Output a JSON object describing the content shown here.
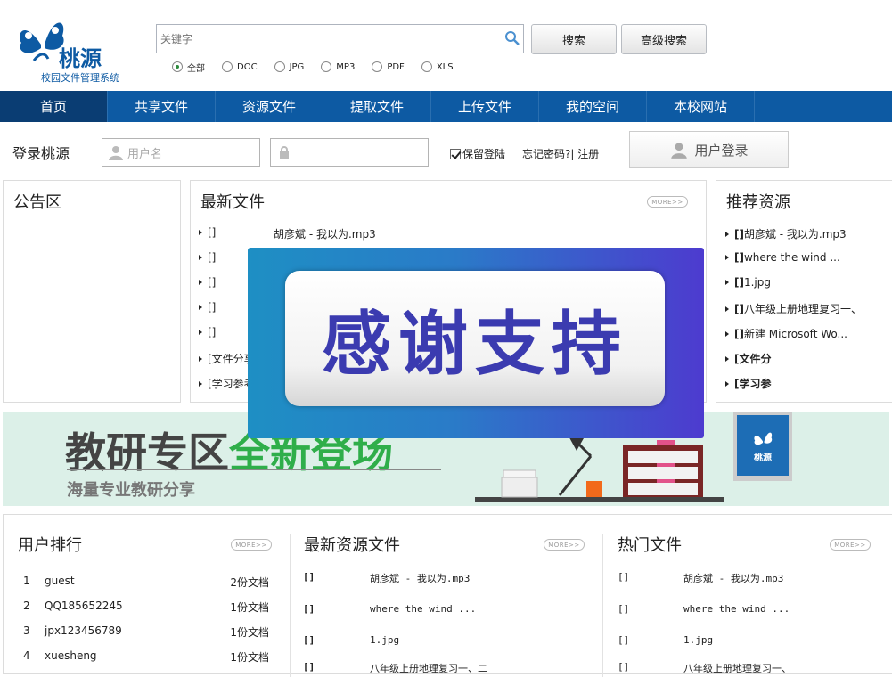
{
  "logo": {
    "name": "桃源",
    "subtitle": "校园文件管理系统"
  },
  "search": {
    "placeholder": "关键字",
    "search_button": "搜索",
    "advanced_button": "高级搜索",
    "filters": [
      {
        "label": "全部",
        "selected": true
      },
      {
        "label": "DOC",
        "selected": false
      },
      {
        "label": "JPG",
        "selected": false
      },
      {
        "label": "MP3",
        "selected": false
      },
      {
        "label": "PDF",
        "selected": false
      },
      {
        "label": "XLS",
        "selected": false
      }
    ]
  },
  "nav": {
    "items": [
      "首页",
      "共享文件",
      "资源文件",
      "提取文件",
      "上传文件",
      "我的空间",
      "本校网站"
    ],
    "active_index": 0
  },
  "login": {
    "title": "登录桃源",
    "username_placeholder": "用户名",
    "remember_label": "保留登陆",
    "forgot_label": "忘记密码?| 注册",
    "login_button": "用户登录"
  },
  "announcement": {
    "title": "公告区"
  },
  "latest_files": {
    "title": "最新文件",
    "more": "MORE>>",
    "rows": [
      {
        "tag": "[]",
        "name": "胡彦斌 - 我以为.mp3"
      },
      {
        "tag": "[]",
        "name": ""
      },
      {
        "tag": "[]",
        "name": ""
      },
      {
        "tag": "[]",
        "name": ""
      },
      {
        "tag": "[]",
        "name": ""
      },
      {
        "tag": "[文件分享",
        "name": ""
      },
      {
        "tag": "[学习参考",
        "name": ""
      }
    ]
  },
  "recommended": {
    "title": "推荐资源",
    "items": [
      {
        "tag": "[]",
        "name": "胡彦斌 - 我以为.mp3",
        "bold": false
      },
      {
        "tag": "[]",
        "name": "where the wind ...",
        "bold": false
      },
      {
        "tag": "[]",
        "name": "1.jpg",
        "bold": false
      },
      {
        "tag": "[]",
        "name": "八年级上册地理复习一、",
        "bold": false
      },
      {
        "tag": "[]",
        "name": "新建 Microsoft Wo...",
        "bold": false
      },
      {
        "tag": "[文件分",
        "name": "",
        "bold": true
      },
      {
        "tag": "[学习参",
        "name": "",
        "bold": true
      }
    ]
  },
  "banner": {
    "headline_1": "教研专区",
    "headline_2": "全新登场",
    "subline": "海量专业教研分享",
    "badge": "桃源"
  },
  "popup": {
    "text": "感谢支持"
  },
  "user_rank": {
    "title": "用户排行",
    "more": "MORE>>",
    "rows": [
      {
        "rank": "1",
        "user": "guest",
        "count": "2份文档"
      },
      {
        "rank": "2",
        "user": "QQ185652245",
        "count": "1份文档"
      },
      {
        "rank": "3",
        "user": "jpx123456789",
        "count": "1份文档"
      },
      {
        "rank": "4",
        "user": "xuesheng",
        "count": "1份文档"
      }
    ]
  },
  "latest_resources": {
    "title": "最新资源文件",
    "more": "MORE>>",
    "rows": [
      {
        "tag": "[]",
        "name": "胡彦斌 - 我以为.mp3"
      },
      {
        "tag": "[]",
        "name": "where the wind ..."
      },
      {
        "tag": "[]",
        "name": "1.jpg"
      },
      {
        "tag": "[]",
        "name": "八年级上册地理复习一、二"
      }
    ]
  },
  "hot_files": {
    "title": "热门文件",
    "more": "MORE>>",
    "rows": [
      {
        "tag": "[]",
        "name": "胡彦斌 - 我以为.mp3"
      },
      {
        "tag": "[]",
        "name": "where the wind ..."
      },
      {
        "tag": "[]",
        "name": "1.jpg"
      },
      {
        "tag": "[]",
        "name": "八年级上册地理复习一、"
      }
    ]
  },
  "colors": {
    "nav": "#0d5aa3",
    "nav_active": "#0a3d73",
    "banner_bg": "#dcf0e8",
    "popup_text": "#3b3bb0"
  }
}
